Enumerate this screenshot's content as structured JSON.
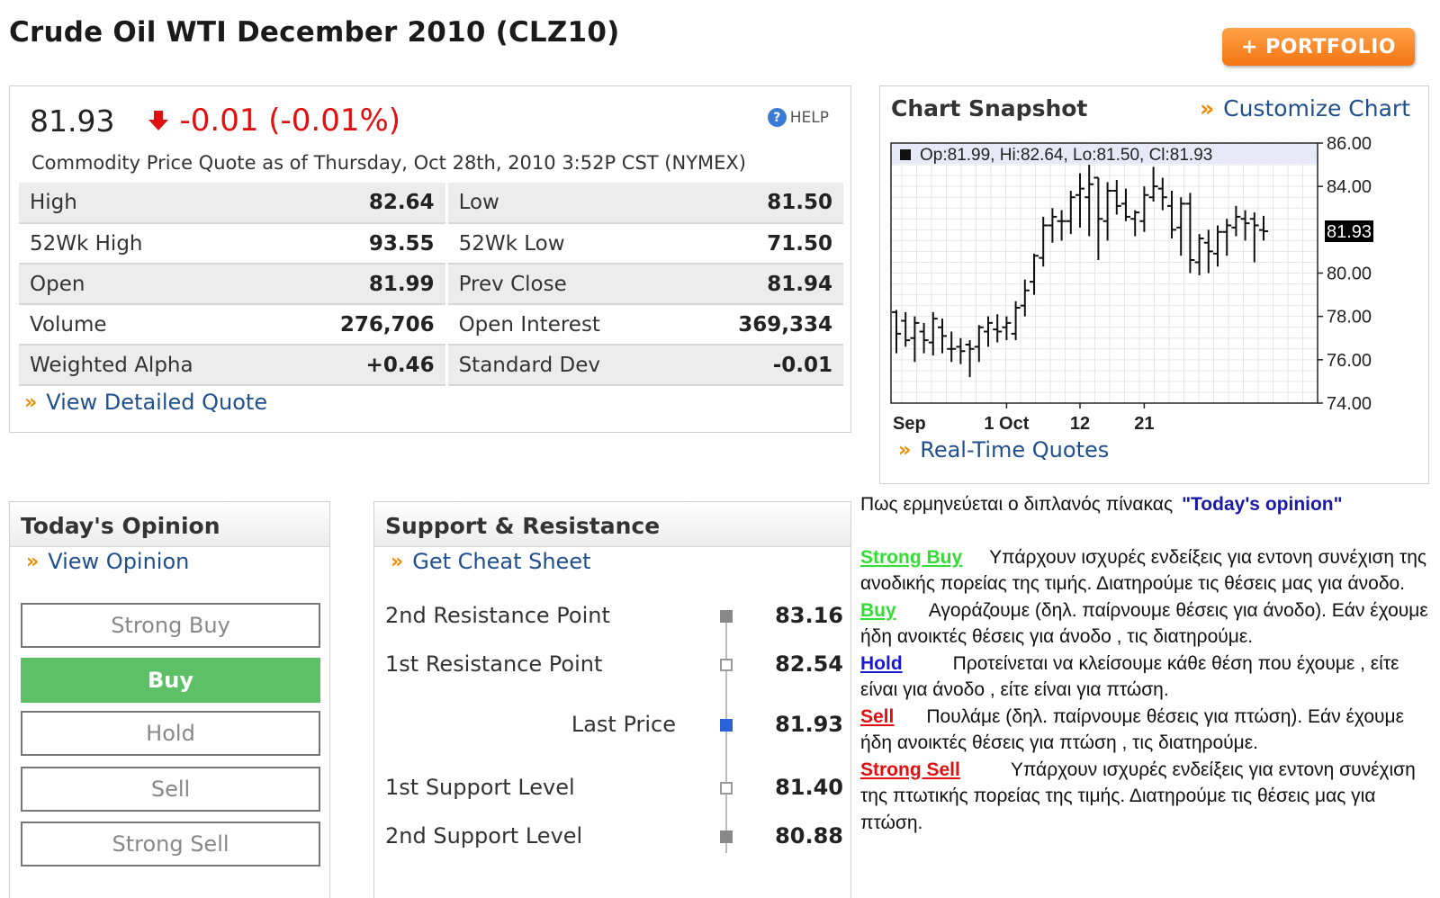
{
  "page": {
    "title": "Crude Oil WTI December 2010 (CLZ10)",
    "portfolio_button": "+ PORTFOLIO"
  },
  "quote": {
    "last": "81.93",
    "change": "-0.01 (-0.01%)",
    "help": "HELP",
    "as_of": "Commodity Price Quote as of Thursday, Oct 28th, 2010 3:52P CST (NYMEX)",
    "rows": [
      {
        "l1": "High",
        "v1": "82.64",
        "l2": "Low",
        "v2": "81.50"
      },
      {
        "l1": "52Wk High",
        "v1": "93.55",
        "l2": "52Wk Low",
        "v2": "71.50"
      },
      {
        "l1": "Open",
        "v1": "81.99",
        "l2": "Prev Close",
        "v2": "81.94"
      },
      {
        "l1": "Volume",
        "v1": "276,706",
        "l2": "Open Interest",
        "v2": "369,334"
      },
      {
        "l1": "Weighted Alpha",
        "v1": "+0.46",
        "l2": "Standard Dev",
        "v2": "-0.01"
      }
    ],
    "detailed_link": "View Detailed Quote",
    "down_color": "#e01010"
  },
  "chart": {
    "title": "Chart Snapshot",
    "customize_link": "Customize Chart",
    "realtime_link": "Real-Time Quotes"
  },
  "chart_data": {
    "type": "ohlc",
    "legend": "Op:81.99, Hi:82.64, Lo:81.50, Cl:81.93",
    "ylim": [
      74,
      86
    ],
    "yticks": [
      "86.00",
      "84.00",
      "80.00",
      "78.00",
      "76.00",
      "74.00"
    ],
    "last_label": "81.93",
    "xtick_labels": [
      "Sep",
      "1 Oct",
      "12",
      "21"
    ],
    "bars": [
      {
        "o": 78.2,
        "h": 78.3,
        "l": 76.3,
        "c": 77.2
      },
      {
        "o": 77.8,
        "h": 78.2,
        "l": 76.6,
        "c": 76.9
      },
      {
        "o": 77.0,
        "h": 78.0,
        "l": 75.9,
        "c": 77.7
      },
      {
        "o": 77.3,
        "h": 77.7,
        "l": 76.3,
        "c": 76.9
      },
      {
        "o": 76.8,
        "h": 78.2,
        "l": 76.2,
        "c": 77.9
      },
      {
        "o": 77.5,
        "h": 77.9,
        "l": 76.3,
        "c": 77.1
      },
      {
        "o": 76.5,
        "h": 77.3,
        "l": 75.9,
        "c": 76.5
      },
      {
        "o": 76.6,
        "h": 77.0,
        "l": 75.8,
        "c": 76.4
      },
      {
        "o": 76.7,
        "h": 76.9,
        "l": 75.2,
        "c": 76.5
      },
      {
        "o": 76.6,
        "h": 77.6,
        "l": 75.9,
        "c": 77.5
      },
      {
        "o": 77.3,
        "h": 78.0,
        "l": 76.6,
        "c": 77.7
      },
      {
        "o": 77.4,
        "h": 78.1,
        "l": 76.8,
        "c": 77.3
      },
      {
        "o": 77.5,
        "h": 78.0,
        "l": 76.9,
        "c": 77.7
      },
      {
        "o": 77.2,
        "h": 78.7,
        "l": 76.9,
        "c": 78.4
      },
      {
        "o": 78.5,
        "h": 79.7,
        "l": 78.0,
        "c": 79.2
      },
      {
        "o": 79.6,
        "h": 80.9,
        "l": 79.0,
        "c": 80.8
      },
      {
        "o": 80.7,
        "h": 82.6,
        "l": 80.3,
        "c": 82.2
      },
      {
        "o": 82.2,
        "h": 83.0,
        "l": 81.4,
        "c": 82.6
      },
      {
        "o": 82.4,
        "h": 82.9,
        "l": 81.5,
        "c": 82.4
      },
      {
        "o": 82.4,
        "h": 83.8,
        "l": 81.8,
        "c": 83.5
      },
      {
        "o": 83.6,
        "h": 84.6,
        "l": 82.1,
        "c": 83.9
      },
      {
        "o": 83.5,
        "h": 85.0,
        "l": 81.7,
        "c": 84.1
      },
      {
        "o": 84.4,
        "h": 84.4,
        "l": 80.6,
        "c": 82.5
      },
      {
        "o": 82.4,
        "h": 84.2,
        "l": 81.5,
        "c": 83.8
      },
      {
        "o": 83.8,
        "h": 84.3,
        "l": 82.7,
        "c": 83.1
      },
      {
        "o": 83.2,
        "h": 83.9,
        "l": 82.4,
        "c": 82.6
      },
      {
        "o": 82.5,
        "h": 82.9,
        "l": 81.7,
        "c": 82.8
      },
      {
        "o": 82.4,
        "h": 84.0,
        "l": 81.9,
        "c": 83.6
      },
      {
        "o": 83.5,
        "h": 84.9,
        "l": 83.3,
        "c": 84.0
      },
      {
        "o": 83.9,
        "h": 84.4,
        "l": 82.9,
        "c": 83.5
      },
      {
        "o": 83.1,
        "h": 83.8,
        "l": 81.6,
        "c": 82.0
      },
      {
        "o": 82.1,
        "h": 83.5,
        "l": 80.8,
        "c": 83.2
      },
      {
        "o": 83.2,
        "h": 83.7,
        "l": 80.0,
        "c": 80.6
      },
      {
        "o": 80.5,
        "h": 81.8,
        "l": 79.9,
        "c": 81.6
      },
      {
        "o": 81.4,
        "h": 82.0,
        "l": 80.0,
        "c": 81.0
      },
      {
        "o": 80.9,
        "h": 82.2,
        "l": 80.3,
        "c": 81.9
      },
      {
        "o": 81.9,
        "h": 82.5,
        "l": 80.8,
        "c": 82.2
      },
      {
        "o": 82.1,
        "h": 83.1,
        "l": 81.7,
        "c": 82.6
      },
      {
        "o": 82.5,
        "h": 82.9,
        "l": 81.5,
        "c": 82.3
      },
      {
        "o": 82.5,
        "h": 82.8,
        "l": 80.5,
        "c": 82.2
      },
      {
        "o": 81.99,
        "h": 82.64,
        "l": 81.5,
        "c": 81.93
      }
    ]
  },
  "opinion": {
    "title": "Today's Opinion",
    "view_link": "View Opinion",
    "options": [
      "Strong Buy",
      "Buy",
      "Hold",
      "Sell",
      "Strong Sell"
    ],
    "active": "Buy",
    "active_color": "#5cc066"
  },
  "sr": {
    "title": "Support & Resistance",
    "cheat_link": "Get Cheat Sheet",
    "rows": [
      {
        "label": "2nd Resistance Point",
        "value": "83.16"
      },
      {
        "label": "1st Resistance Point",
        "value": "82.54"
      },
      {
        "label": "Last Price",
        "value": "81.93"
      },
      {
        "label": "1st Support Level",
        "value": "81.40"
      },
      {
        "label": "2nd Support Level",
        "value": "80.88"
      }
    ]
  },
  "legend": {
    "intro": "Πως ερμηνεύεται ο διπλανός πίνακας",
    "intro_quote": "\"Today's opinion\"",
    "items": [
      {
        "term": "Strong Buy",
        "color": "#33dd33",
        "text": "Υπάρχουν ισχυρές ενδείξεις για εντονη συνέχιση της ανοδικής πορείας της τιμής. Διατηρούμε τις θέσεις μας για άνοδο."
      },
      {
        "term": "Buy",
        "color": "#33dd33",
        "text": "Αγοράζουμε (δηλ. παίρνουμε θέσεις για άνοδο). Εάν έχουμε ήδη ανοικτές θέσεις για άνοδο , τις διατηρούμε."
      },
      {
        "term": "Hold",
        "color": "#1a1ad0",
        "text": "Προτείνεται να κλείσουμε κάθε θέση που έχουμε , είτε είναι για άνοδο , είτε είναι για πτώση."
      },
      {
        "term": "Sell",
        "color": "#e01010",
        "text": "Πουλάμε (δηλ. παίρνουμε θέσεις για πτώση). Εάν έχουμε ήδη ανοικτές θέσεις για πτώση , τις διατηρούμε."
      },
      {
        "term": "Strong Sell",
        "color": "#e01010",
        "text": "Υπάρχουν ισχυρές ενδείξεις για εντονη συνέχιση της πτωτικής πορείας της τιμής. Διατηρούμε τις θέσεις μας για πτώση."
      }
    ]
  }
}
